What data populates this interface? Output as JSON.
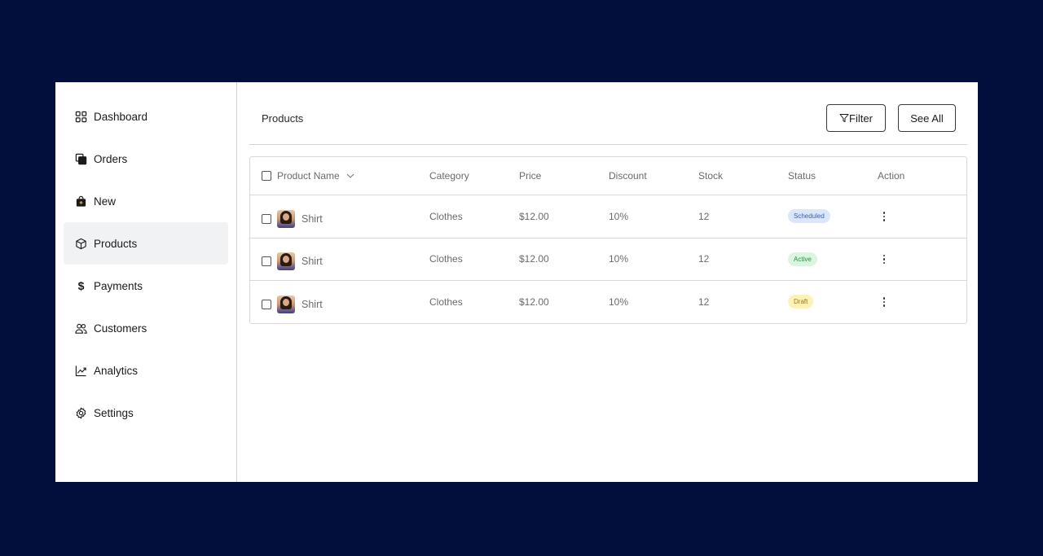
{
  "sidebar": {
    "items": [
      {
        "label": "Dashboard",
        "icon": "grid-icon",
        "active": false
      },
      {
        "label": "Orders",
        "icon": "orders-icon",
        "active": false
      },
      {
        "label": "New",
        "icon": "shopping-bag-icon",
        "active": false
      },
      {
        "label": "Products",
        "icon": "box-icon",
        "active": true
      },
      {
        "label": "Payments",
        "icon": "dollar-icon",
        "active": false
      },
      {
        "label": "Customers",
        "icon": "users-icon",
        "active": false
      },
      {
        "label": "Analytics",
        "icon": "chart-line-icon",
        "active": false
      },
      {
        "label": "Settings",
        "icon": "gear-icon",
        "active": false
      }
    ]
  },
  "header": {
    "title": "Products",
    "filter_label": "Filter",
    "see_all_label": "See All"
  },
  "table": {
    "columns": [
      "Product Name",
      "Category",
      "Price",
      "Discount",
      "Stock",
      "Status",
      "Action"
    ],
    "rows": [
      {
        "name": "Shirt",
        "category": "Clothes",
        "price": "$12.00",
        "discount": "10%",
        "stock": "12",
        "status": "Scheduled",
        "status_type": "scheduled"
      },
      {
        "name": "Shirt",
        "category": "Clothes",
        "price": "$12.00",
        "discount": "10%",
        "stock": "12",
        "status": "Active",
        "status_type": "active"
      },
      {
        "name": "Shirt",
        "category": "Clothes",
        "price": "$12.00",
        "discount": "10%",
        "stock": "12",
        "status": "Draft",
        "status_type": "draft"
      }
    ]
  },
  "colors": {
    "background": "#020f3d",
    "active_nav": "#f1f2f4",
    "scheduled_badge": "#d9e6fb",
    "active_badge": "#dcf5e1",
    "draft_badge": "#fcf2b8"
  }
}
